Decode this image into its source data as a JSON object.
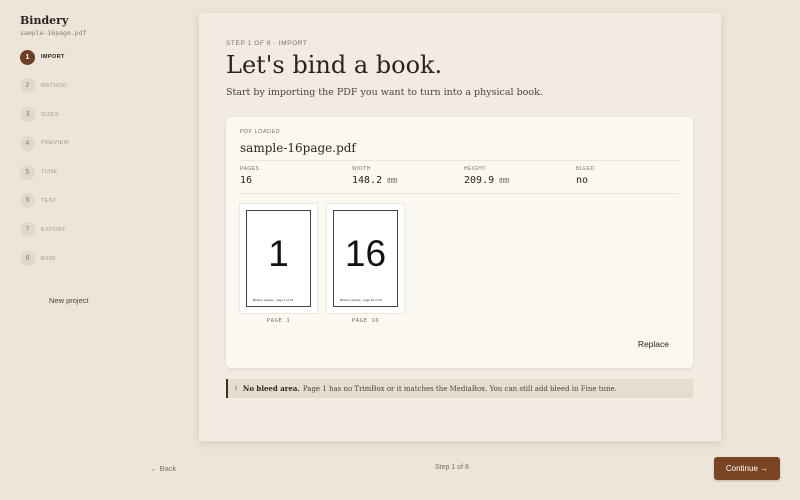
{
  "app": {
    "name": "Bindery",
    "file": "sample-16page.pdf"
  },
  "sidebar": {
    "steps": [
      {
        "num": "1",
        "label": "IMPORT",
        "active": true
      },
      {
        "num": "2",
        "label": "METHOD"
      },
      {
        "num": "3",
        "label": "SIZES"
      },
      {
        "num": "4",
        "label": "PREVIEW"
      },
      {
        "num": "5",
        "label": "TUNE"
      },
      {
        "num": "6",
        "label": "TEST"
      },
      {
        "num": "7",
        "label": "EXPORT"
      },
      {
        "num": "8",
        "label": "BIND"
      }
    ],
    "new_project": "New project"
  },
  "main": {
    "eyebrow": "STEP 1 OF 8 · IMPORT",
    "title": "Let's bind a book.",
    "subtitle": "Start by importing the PDF you want to turn into a physical book.",
    "pdf": {
      "label": "PDF LOADED",
      "name": "sample-16page.pdf",
      "meta": {
        "pages": {
          "label": "PAGES",
          "value": "16"
        },
        "width": {
          "label": "WIDTH",
          "value": "148.2",
          "unit": "mm"
        },
        "height": {
          "label": "HEIGHT",
          "value": "209.9",
          "unit": "mm"
        },
        "bleed": {
          "label": "BLEED",
          "value": "no"
        }
      },
      "thumbs": [
        {
          "number": "1",
          "footer": "Bindery sample · page 1 of 16",
          "caption": "PAGE 1"
        },
        {
          "number": "16",
          "footer": "Bindery sample · page 16 of 16",
          "caption": "PAGE 16"
        }
      ],
      "replace": "Replace"
    },
    "notice": {
      "icon": "i",
      "strong": "No bleed area.",
      "text": "Page 1 has no TrimBox or it matches the MediaBox. You can still add bleed in Fine tune."
    }
  },
  "footer": {
    "back": "← Back",
    "step": "Step 1 of 8",
    "continue": "Continue →"
  },
  "colors": {
    "accent": "#7a4524",
    "background": "#ece5da",
    "card": "#f1ebe1"
  }
}
